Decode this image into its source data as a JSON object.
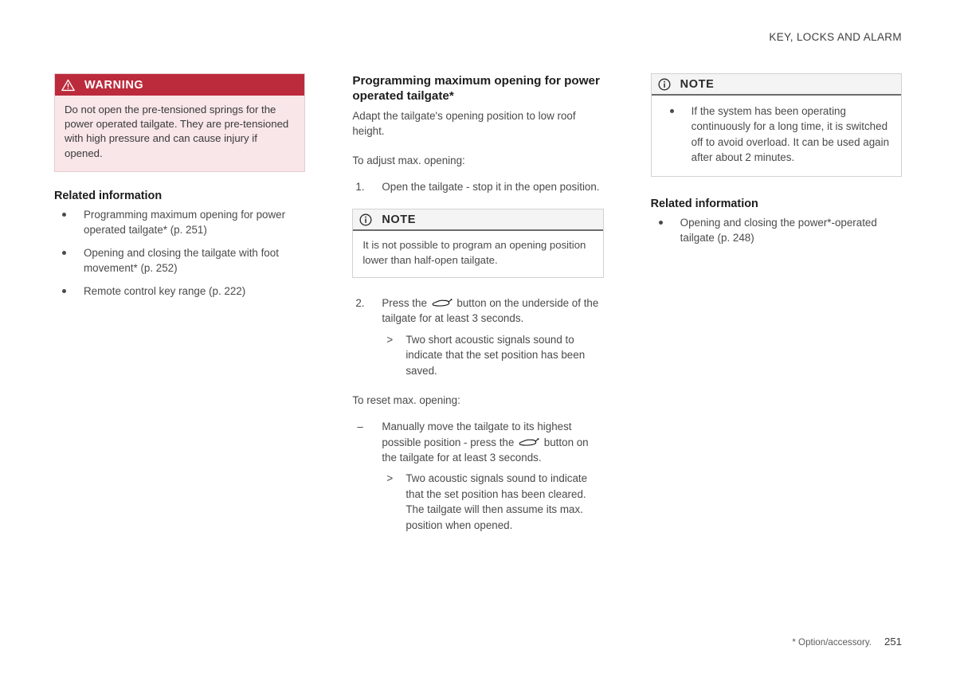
{
  "header": {
    "title": "KEY, LOCKS AND ALARM"
  },
  "footer": {
    "option_note": "* Option/accessory.",
    "page_number": "251"
  },
  "left_column": {
    "warning": {
      "icon": "warning-triangle-icon",
      "label": "WARNING",
      "body": "Do not open the pre-tensioned springs for the power operated tailgate. They are pre-tensioned with high pressure and can cause injury if opened.",
      "header_color": "#bb2b3c",
      "body_color": "#f9e6e9"
    },
    "related": {
      "title": "Related information",
      "items": [
        "Programming maximum opening for power operated tailgate* (p. 251)",
        "Opening and closing the tailgate with foot movement* (p. 252)",
        "Remote control key range (p. 222)"
      ]
    }
  },
  "middle_column": {
    "section_title": "Programming maximum opening for power operated tailgate*",
    "intro": "Adapt the tailgate's opening position to low roof height.",
    "adjust_label": "To adjust max. opening:",
    "step1": {
      "num": "1.",
      "text": "Open the tailgate - stop it in the open position."
    },
    "note": {
      "icon": "info-circle-icon",
      "label": "NOTE",
      "body": "It is not possible to program an opening position lower than half-open tailgate."
    },
    "step2": {
      "num": "2.",
      "text_before": "Press the",
      "icon": "tailgate-button-icon",
      "text_after": "button on the underside of the tailgate for at least 3 seconds.",
      "result": "Two short acoustic signals sound to indicate that the set position has been saved."
    },
    "reset_label": "To reset max. opening:",
    "reset_step": {
      "text_before": "Manually move the tailgate to its highest possible position - press the",
      "icon": "tailgate-button-icon",
      "text_after": "button on the tailgate for at least 3 seconds.",
      "result": "Two acoustic signals sound to indicate that the set position has been cleared. The tailgate will then assume its max. position when opened."
    }
  },
  "right_column": {
    "note": {
      "icon": "info-circle-icon",
      "label": "NOTE",
      "items": [
        "If the system has been operating continuously for a long time, it is switched off to avoid overload. It can be used again after about 2 minutes."
      ]
    },
    "related": {
      "title": "Related information",
      "items": [
        "Opening and closing the power*-operated tailgate (p. 248)"
      ]
    }
  }
}
